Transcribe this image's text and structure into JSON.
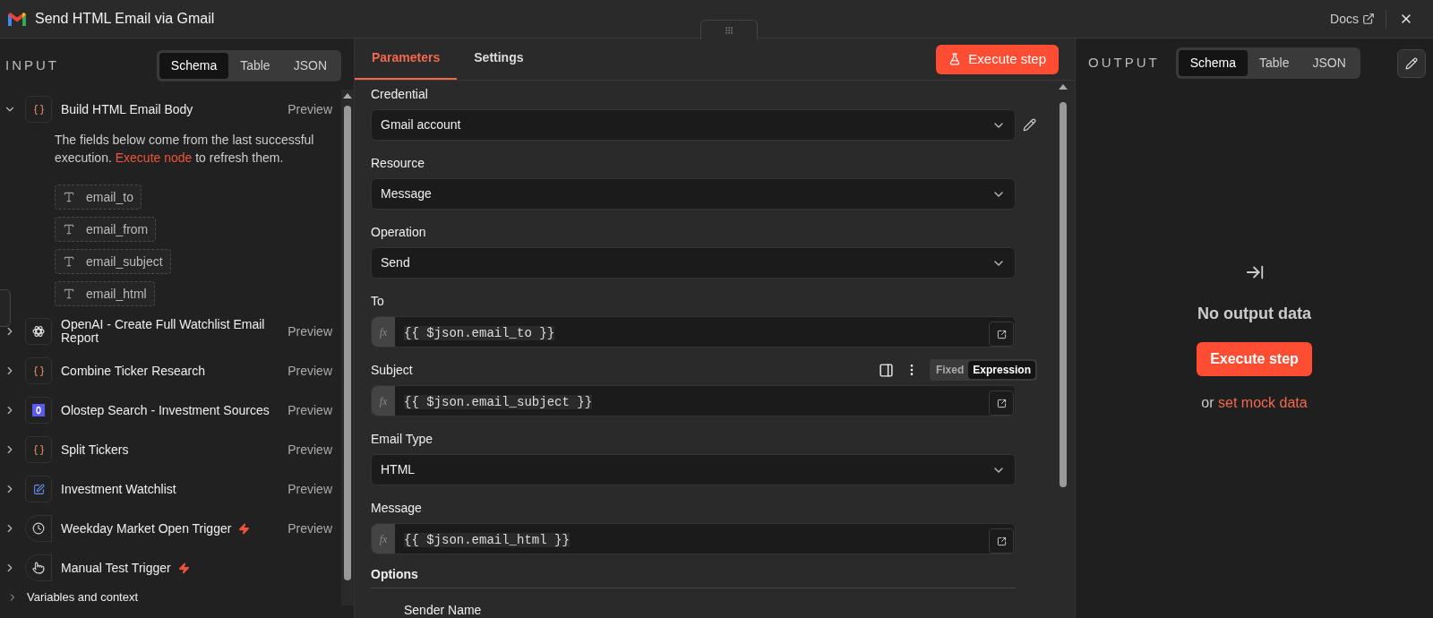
{
  "window": {
    "title": "Send HTML Email via Gmail",
    "docs": "Docs"
  },
  "input": {
    "heading": "INPUT",
    "tabs": [
      {
        "label": "Schema",
        "selected": true
      },
      {
        "label": "Table",
        "selected": false
      },
      {
        "label": "JSON",
        "selected": false
      }
    ],
    "nodes": [
      {
        "name": "Build HTML Email Body",
        "kind": "code",
        "expanded": true,
        "trigger": false,
        "preview": "Preview",
        "note": {
          "before": "The fields below come from the last successful execution.",
          "link": "Execute node",
          "after": "to refresh them."
        },
        "fields": [
          "email_to",
          "email_from",
          "email_subject",
          "email_html"
        ]
      },
      {
        "name": "OpenAI - Create Full Watchlist Email Report",
        "kind": "openai",
        "expanded": false,
        "trigger": false,
        "preview": "Preview"
      },
      {
        "name": "Combine Ticker Research",
        "kind": "code",
        "expanded": false,
        "trigger": false,
        "preview": "Preview"
      },
      {
        "name": "Olostep Search - Investment Sources",
        "kind": "olostep",
        "expanded": false,
        "trigger": false,
        "preview": "Preview"
      },
      {
        "name": "Split Tickers",
        "kind": "code",
        "expanded": false,
        "trigger": false,
        "preview": "Preview"
      },
      {
        "name": "Investment Watchlist",
        "kind": "edit",
        "expanded": false,
        "trigger": false,
        "preview": "Preview"
      },
      {
        "name": "Weekday Market Open Trigger",
        "kind": "clock",
        "expanded": false,
        "trigger": true,
        "preview": "Preview"
      },
      {
        "name": "Manual Test Trigger",
        "kind": "cursor",
        "expanded": false,
        "trigger": true
      }
    ],
    "footer": "Variables and context"
  },
  "parameters": {
    "tabs": [
      {
        "label": "Parameters",
        "selected": true
      },
      {
        "label": "Settings",
        "selected": false
      }
    ],
    "execute": "Execute step",
    "fields": [
      {
        "kind": "select",
        "label": "Credential",
        "value": "Gmail account",
        "editable": true
      },
      {
        "kind": "select",
        "label": "Resource",
        "value": "Message",
        "editable": false
      },
      {
        "kind": "select",
        "label": "Operation",
        "value": "Send",
        "editable": false
      },
      {
        "kind": "expression",
        "label": "To",
        "badge": "fx",
        "value": "{{ $json.email_to }}"
      },
      {
        "kind": "expression",
        "label": "Subject",
        "badge": "fx",
        "value": "{{ $json.email_subject }}",
        "mode": [
          {
            "label": "Fixed",
            "selected": false
          },
          {
            "label": "Expression",
            "selected": true
          }
        ]
      },
      {
        "kind": "select",
        "label": "Email Type",
        "value": "HTML",
        "editable": false
      },
      {
        "kind": "expression",
        "label": "Message",
        "badge": "fx",
        "value": "{{ $json.email_html }}"
      }
    ],
    "options": {
      "heading": "Options",
      "items": [
        "Sender Name"
      ]
    }
  },
  "output": {
    "heading": "OUTPUT",
    "tabs": [
      {
        "label": "Schema",
        "selected": true
      },
      {
        "label": "Table",
        "selected": false
      },
      {
        "label": "JSON",
        "selected": false
      }
    ],
    "empty": {
      "title": "No output data",
      "button": "Execute step",
      "before": "or",
      "link": "set mock data"
    }
  }
}
